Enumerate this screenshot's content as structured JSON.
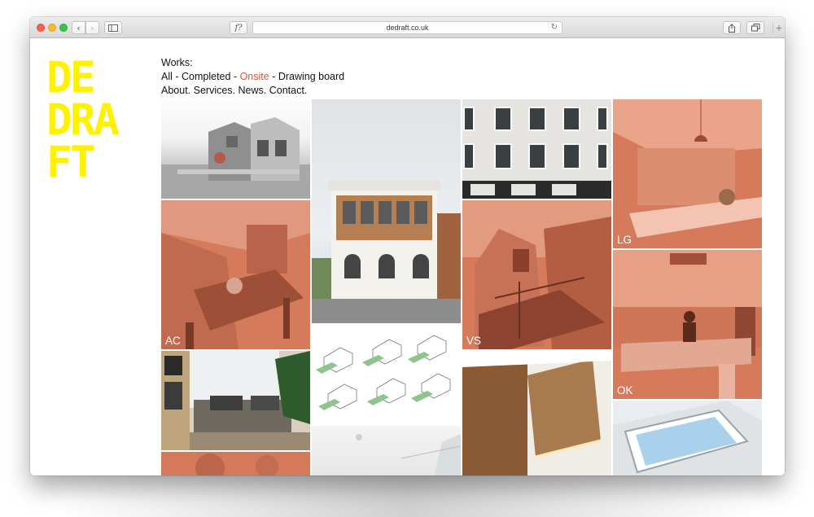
{
  "browser": {
    "url": "dedraft.co.uk",
    "reader_glyph": "f?",
    "back_glyph": "‹",
    "forward_glyph": "›",
    "plus_glyph": "+",
    "reload_glyph": "↻"
  },
  "logo": {
    "lines": [
      "DE",
      "DRA",
      "FT"
    ],
    "color": "#fff200"
  },
  "nav": {
    "works_label": "Works:",
    "filters": {
      "all": "All",
      "completed": "Completed",
      "onsite": "Onsite",
      "drawing_board": "Drawing board",
      "separator": " - "
    },
    "links": {
      "about": "About.",
      "services": "Services.",
      "news": "News.",
      "contact": "Contact."
    },
    "active_color": "#e8502e"
  },
  "projects": [
    {
      "label": "",
      "image": "grey-house-render"
    },
    {
      "label": "AC",
      "image": "kitchen-dining-tinted"
    },
    {
      "label": "",
      "image": "living-room"
    },
    {
      "label": "",
      "image": "tinted-garden-partial"
    },
    {
      "label": "",
      "image": "white-victorian-building"
    },
    {
      "label": "",
      "image": "isometric-drawings"
    },
    {
      "label": "",
      "image": "white-interior-partial"
    },
    {
      "label": "",
      "image": "terrace-windows"
    },
    {
      "label": "VS",
      "image": "construction-site-tinted"
    },
    {
      "label": "",
      "image": "timber-staircase"
    },
    {
      "label": "LG",
      "image": "kitchen-skylight-tinted"
    },
    {
      "label": "OK",
      "image": "kitchen-person-tinted"
    },
    {
      "label": "",
      "image": "skylight-window"
    }
  ],
  "colors": {
    "tint": "#d67a5c"
  }
}
